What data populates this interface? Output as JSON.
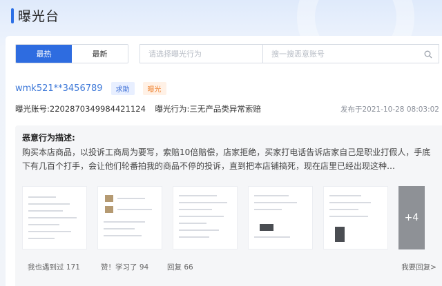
{
  "header": {
    "title": "曝光台"
  },
  "filters": {
    "tabs": [
      {
        "label": "最热",
        "active": true
      },
      {
        "label": "最新",
        "active": false
      }
    ],
    "behavior_select_placeholder": "请选择曝光行为",
    "search_placeholder": "搜一搜恶意账号"
  },
  "post": {
    "username": "wmk521**3456789",
    "tags": {
      "help": "求助",
      "expose": "曝光"
    },
    "account_label": "曝光账号:2202870349984421124",
    "behavior_label": "曝光行为:三无产品类异常索赔",
    "publish_time": "发布于2021-10-28 08:03:02",
    "description": {
      "heading": "恶意行为描述:",
      "text": "购买本店商品，以投诉工商局为要写，索赔10倍赔偿，店家拒绝，买家打电话告诉店家自己是职业打假人，手底下有几百个打手，会让他们轮番拍我的商品不停的投诉，直到把本店铺搞死，现在店里已经出现这种…"
    },
    "more_images": "+4",
    "actions": {
      "met": "我也遇到过 171",
      "like": "赞！学习了 94",
      "reply": "回复 66",
      "want_reply": "我要回复>"
    }
  },
  "colors": {
    "accent": "#2e6ce0",
    "link": "#3d78d8",
    "expose": "#f08a3c"
  }
}
